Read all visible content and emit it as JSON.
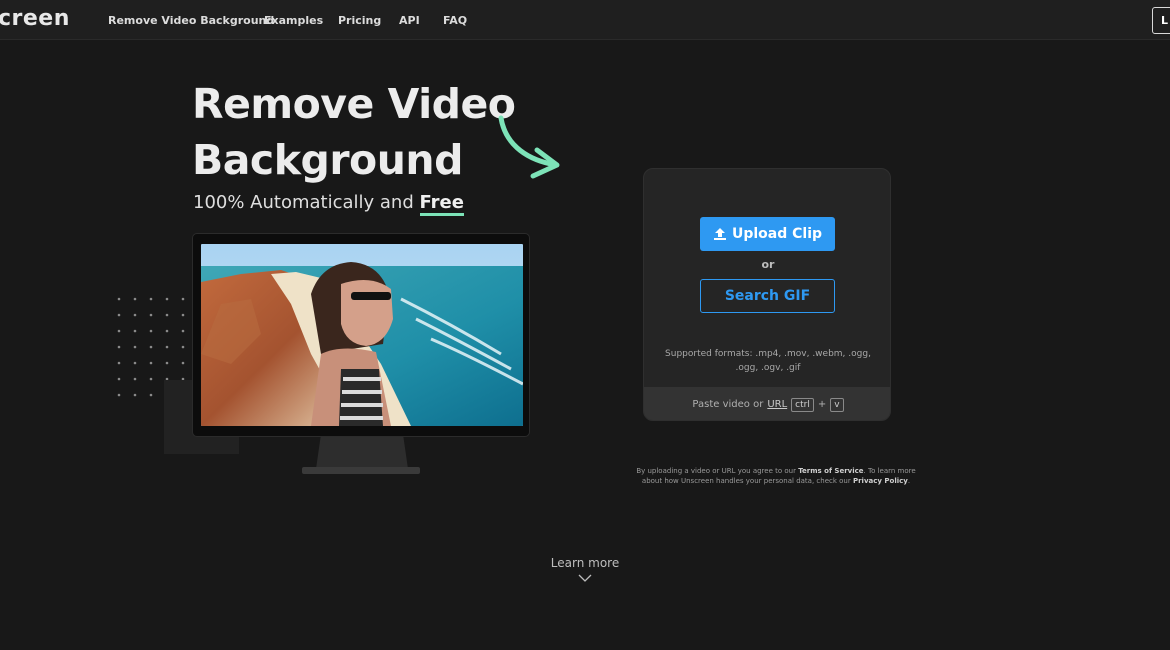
{
  "nav": {
    "logo": "creen",
    "links": [
      "Remove Video Background",
      "Examples",
      "Pricing",
      "API",
      "FAQ"
    ],
    "login_label": "L"
  },
  "hero": {
    "title": "Remove Video Background",
    "subtitle_prefix": "100% Automatically and ",
    "subtitle_highlight": "Free"
  },
  "upload": {
    "upload_label": "Upload Clip",
    "or_label": "or",
    "search_label": "Search GIF",
    "formats": "Supported formats: .mp4, .mov, .webm, .ogg, .ogg, .ogv, .gif",
    "paste_prefix": "Paste video or",
    "paste_url": "URL",
    "key_ctrl": "ctrl",
    "key_plus": "+",
    "key_v": "v"
  },
  "terms": {
    "part1": "By uploading a video or URL you agree to our ",
    "tos": "Terms of Service",
    "part2": ". To learn more about how Unscreen handles your personal data, check our ",
    "privacy": "Privacy Policy",
    "part3": "."
  },
  "footer": {
    "learn_more": "Learn more"
  },
  "colors": {
    "accent": "#2e99f2",
    "highlight": "#7de3b8",
    "background": "#181818"
  }
}
